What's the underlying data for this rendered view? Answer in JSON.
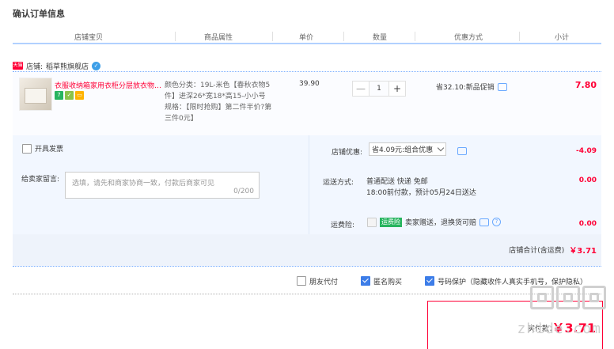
{
  "page": {
    "title": "确认订单信息"
  },
  "columns": {
    "shop_item": "店铺宝贝",
    "attributes": "商品属性",
    "unit_price": "单价",
    "quantity": "数量",
    "promotion": "优惠方式",
    "subtotal": "小计"
  },
  "shop": {
    "prefix": "店铺:",
    "name": "稻草熊旗舰店",
    "logo_text": "天猫"
  },
  "item": {
    "title": "衣服收纳箱家用衣柜分层放衣物…",
    "attributes": [
      "颜色分类：19L-米色【春秋衣物5件】进深26*宽18*高15-小小号",
      "规格：【限时抢购】第二件半价?第三件0元】"
    ],
    "price": "39.90",
    "quantity": "1",
    "qty_minus": "—",
    "qty_plus": "+",
    "promotion": "省32.10:新品促销",
    "subtotal": "7.80"
  },
  "options": {
    "invoice_label": "开具发票",
    "memo_label": "给卖家留言:",
    "memo_placeholder": "选填，请先和商家协商一致，付款后商家可见",
    "memo_count": "0/200",
    "shop_discount_label": "店铺优惠:",
    "shop_discount_value": "省4.09元:组合优惠",
    "shop_discount_amount": "-4.09",
    "shipping_label": "运送方式:",
    "shipping_method": "普通配送 快递 免邮",
    "shipping_eta": "18:00前付款，预计05月24日送达",
    "shipping_amount": "0.00",
    "insurance_label": "运费险:",
    "insurance_badge": "运费险",
    "insurance_text": "卖家赠送，退换货可赔",
    "insurance_amount": "0.00"
  },
  "shop_total": {
    "label": "店铺合计(含运费)",
    "value": "￥3.71"
  },
  "checkout_options": {
    "friend_pay": "朋友代付",
    "anonymous": "匿名购买",
    "number_protect": "号码保护（隐藏收件人真实手机号，保护隐私）"
  },
  "payment": {
    "label": "实付款：",
    "value": "￥3.71"
  },
  "watermark": {
    "text": "zhide.com"
  },
  "colors": {
    "accent_red": "#ff0036",
    "link_blue": "#3d7de8",
    "panel_blue": "#f2f7ff"
  }
}
